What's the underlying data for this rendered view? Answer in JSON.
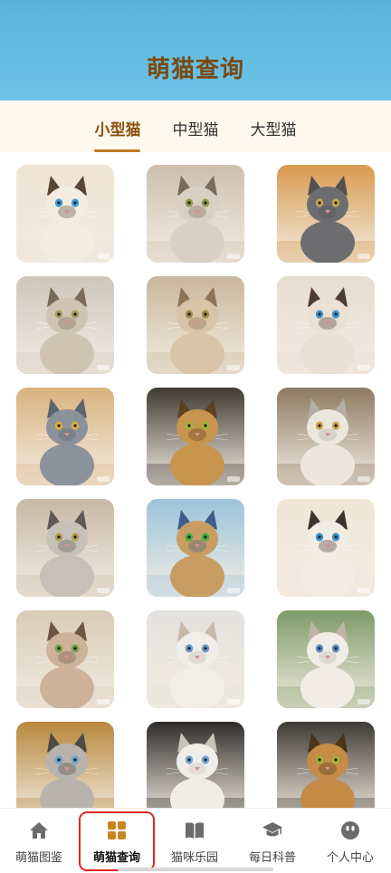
{
  "header": {
    "title": "萌猫查询"
  },
  "tabs": [
    {
      "label": "小型猫",
      "active": true
    },
    {
      "label": "中型猫",
      "active": false
    },
    {
      "label": "大型猫",
      "active": false
    }
  ],
  "cats": [
    {
      "name": "siamese-cat-photo",
      "bg": "#efe3d3",
      "fur": "#f4ece0",
      "accent": "#5a4636",
      "eye": "#3a9bd6"
    },
    {
      "name": "tabby-kitten-photo",
      "bg": "#cdbfae",
      "fur": "#d9cfc2",
      "accent": "#7c6b5a",
      "eye": "#8a9a4a"
    },
    {
      "name": "grey-fluffy-cat-photo",
      "bg": "#d89a4e",
      "fur": "#6d6d70",
      "accent": "#505055",
      "eye": "#c8a64a"
    },
    {
      "name": "tabby-lying-cat-photo",
      "bg": "#cfc6ba",
      "fur": "#cfc3b2",
      "accent": "#7a6a58",
      "eye": "#a79d5c"
    },
    {
      "name": "cream-tabby-looking-up-photo",
      "bg": "#c9b79c",
      "fur": "#d8c4a6",
      "accent": "#8c7455",
      "eye": "#9b8a4a"
    },
    {
      "name": "siamese-sitting-photo",
      "bg": "#e6ddd1",
      "fur": "#eae1d4",
      "accent": "#4e3c30",
      "eye": "#3d94cf"
    },
    {
      "name": "russian-blue-photo",
      "bg": "#d9b27e",
      "fur": "#8b929b",
      "accent": "#5f656e",
      "eye": "#d7b43a"
    },
    {
      "name": "bengal-lying-cat-photo",
      "bg": "#3f3a33",
      "fur": "#c7954e",
      "accent": "#5b4022",
      "eye": "#9fb33c"
    },
    {
      "name": "british-shorthair-cream-photo",
      "bg": "#8e7a62",
      "fur": "#ece6dc",
      "accent": "#b5aea4",
      "eye": "#caa44a"
    },
    {
      "name": "maine-coon-kitten-photo",
      "bg": "#c8b9a6",
      "fur": "#c7c0b6",
      "accent": "#5e5a55",
      "eye": "#b59d4c"
    },
    {
      "name": "pharaoh-cat-pyramids-art",
      "bg": "#9bc4dc",
      "fur": "#c99d62",
      "accent": "#3d5d8c",
      "eye": "#3fb04a"
    },
    {
      "name": "siamese-lying-photo",
      "bg": "#efe6d6",
      "fur": "#f1ece4",
      "accent": "#3f342d",
      "eye": "#3b92cf"
    },
    {
      "name": "sphynx-sitting-photo",
      "bg": "#d9cbb6",
      "fur": "#cdb29a",
      "accent": "#6e5544",
      "eye": "#7aa04e"
    },
    {
      "name": "white-fluffy-cat-photo",
      "bg": "#e3e1de",
      "fur": "#f1ede8",
      "accent": "#c8b9a9",
      "eye": "#6b9ad0"
    },
    {
      "name": "white-cat-garden-photo",
      "bg": "#7d9a67",
      "fur": "#f1ede6",
      "accent": "#bfb4a8",
      "eye": "#5b8fc8"
    },
    {
      "name": "tabby-kitten-grey-photo",
      "bg": "#b8883c",
      "fur": "#b8b3ad",
      "accent": "#4d4a46",
      "eye": "#6fa4c9"
    },
    {
      "name": "white-kitten-dark-bg-photo",
      "bg": "#2f2c2a",
      "fur": "#f0ede8",
      "accent": "#c9c2b8",
      "eye": "#6ea2d6"
    },
    {
      "name": "abyssinian-cat-photo",
      "bg": "#3e3a35",
      "fur": "#c48c46",
      "accent": "#4e3418",
      "eye": "#9db63a"
    }
  ],
  "nav": [
    {
      "label": "萌猫图鉴",
      "icon": "home-icon",
      "active": false
    },
    {
      "label": "萌猫查询",
      "icon": "grid-icon",
      "active": true,
      "color": "#c8861f"
    },
    {
      "label": "猫咪乐园",
      "icon": "book-icon",
      "active": false
    },
    {
      "label": "每日科普",
      "icon": "graduation-cap-icon",
      "active": false
    },
    {
      "label": "个人中心",
      "icon": "user-face-icon",
      "active": false
    }
  ],
  "colors": {
    "header": "#5bb6de",
    "active_tab": "#8a520e",
    "highlight": "#e02626",
    "icon_grey": "#6b6b6b"
  }
}
